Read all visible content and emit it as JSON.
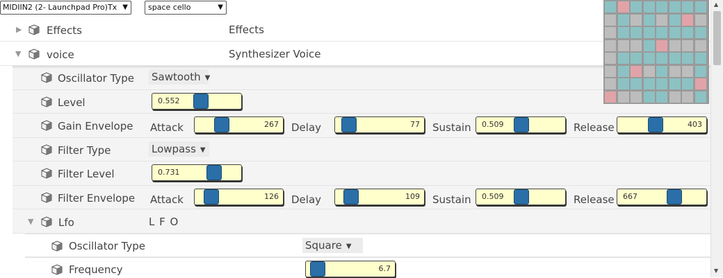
{
  "toolbar": {
    "midi_device": "MIDIIN2 (2- Launchpad Pro)Tx",
    "patch": "space cello"
  },
  "tree": {
    "effects": {
      "label": "Effects",
      "description": "Effects"
    },
    "voice": {
      "label": "voice",
      "description": "Synthesizer Voice"
    }
  },
  "voice_params": {
    "osc_type": {
      "label": "Oscillator Type",
      "value": "Sawtooth"
    },
    "level": {
      "label": "Level",
      "value": "0.552"
    },
    "gain_env": {
      "label": "Gain Envelope",
      "attack_label": "Attack",
      "attack": "267",
      "delay_label": "Delay",
      "delay": "77",
      "sustain_label": "Sustain",
      "sustain": "0.509",
      "release_label": "Release",
      "release": "403"
    },
    "filter_type": {
      "label": "Filter Type",
      "value": "Lowpass"
    },
    "filter_level": {
      "label": "Filter Level",
      "value": "0.731"
    },
    "filter_env": {
      "label": "Filter Envelope",
      "attack_label": "Attack",
      "attack": "126",
      "delay_label": "Delay",
      "delay": "109",
      "sustain_label": "Sustain",
      "sustain": "0.509",
      "release_label": "Release",
      "release": "667"
    },
    "lfo": {
      "label": "Lfo",
      "description": "L F O"
    }
  },
  "lfo_params": {
    "osc_type": {
      "label": "Oscillator Type",
      "value": "Square"
    },
    "frequency": {
      "label": "Frequency",
      "value": "6.7"
    }
  },
  "launchpad": {
    "colors": {
      "gray": "#bdbdbd",
      "teal": "#8cc2c4",
      "pink": "#e1a3a8"
    },
    "cells": [
      [
        "teal",
        "pink",
        "teal",
        "teal",
        "teal",
        "teal",
        "teal",
        "teal"
      ],
      [
        "gray",
        "teal",
        "gray",
        "teal",
        "gray",
        "teal",
        "pink",
        "gray"
      ],
      [
        "gray",
        "teal",
        "teal",
        "teal",
        "teal",
        "teal",
        "teal",
        "teal"
      ],
      [
        "gray",
        "gray",
        "gray",
        "teal",
        "pink",
        "gray",
        "gray",
        "gray"
      ],
      [
        "gray",
        "teal",
        "teal",
        "teal",
        "teal",
        "teal",
        "teal",
        "teal"
      ],
      [
        "gray",
        "teal",
        "pink",
        "gray",
        "teal",
        "gray",
        "gray",
        "teal"
      ],
      [
        "gray",
        "teal",
        "teal",
        "teal",
        "teal",
        "teal",
        "teal",
        "pink"
      ],
      [
        "pink",
        "gray",
        "gray",
        "teal",
        "teal",
        "gray",
        "gray",
        "teal"
      ]
    ]
  },
  "colors": {
    "slider_bg": "#ffffcc",
    "knob": "#2a6fa8"
  }
}
